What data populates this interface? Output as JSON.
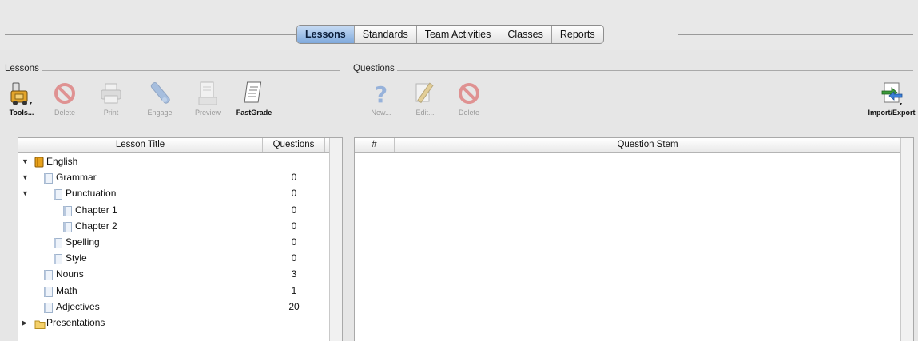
{
  "tabs": [
    {
      "label": "Lessons",
      "active": true
    },
    {
      "label": "Standards",
      "active": false
    },
    {
      "label": "Team Activities",
      "active": false
    },
    {
      "label": "Classes",
      "active": false
    },
    {
      "label": "Reports",
      "active": false
    }
  ],
  "lessons_section": {
    "title": "Lessons",
    "toolbar": [
      {
        "label": "Tools...",
        "icon": "tools-icon",
        "enabled": true
      },
      {
        "label": "Delete",
        "icon": "delete-icon",
        "enabled": false
      },
      {
        "label": "Print",
        "icon": "print-icon",
        "enabled": false
      },
      {
        "label": "Engage",
        "icon": "engage-icon",
        "enabled": false
      },
      {
        "label": "Preview",
        "icon": "preview-icon",
        "enabled": false
      },
      {
        "label": "FastGrade",
        "icon": "fastgrade-icon",
        "enabled": true
      }
    ],
    "columns": {
      "title": "Lesson Title",
      "questions": "Questions"
    },
    "rows": [
      {
        "title": "English",
        "questions": "",
        "level": 0,
        "expander": "expanded",
        "icon": "book-icon"
      },
      {
        "title": "Grammar",
        "questions": "0",
        "level": 1,
        "expander": "expanded",
        "icon": "lesson-doc-icon"
      },
      {
        "title": "Punctuation",
        "questions": "0",
        "level": 2,
        "expander": "expanded",
        "icon": "lesson-doc-icon"
      },
      {
        "title": "Chapter 1",
        "questions": "0",
        "level": 3,
        "expander": "none",
        "icon": "lesson-doc-icon"
      },
      {
        "title": "Chapter 2",
        "questions": "0",
        "level": 3,
        "expander": "none",
        "icon": "lesson-doc-icon"
      },
      {
        "title": "Spelling",
        "questions": "0",
        "level": 2,
        "expander": "none",
        "icon": "lesson-doc-icon"
      },
      {
        "title": "Style",
        "questions": "0",
        "level": 2,
        "expander": "none",
        "icon": "lesson-doc-icon"
      },
      {
        "title": "Nouns",
        "questions": "3",
        "level": 1,
        "expander": "none",
        "icon": "lesson-doc-icon"
      },
      {
        "title": "Math",
        "questions": "1",
        "level": 1,
        "expander": "none",
        "icon": "lesson-doc-icon"
      },
      {
        "title": "Adjectives",
        "questions": "20",
        "level": 1,
        "expander": "none",
        "icon": "lesson-doc-icon"
      },
      {
        "title": "Presentations",
        "questions": "",
        "level": 0,
        "expander": "collapsed",
        "icon": "folder-icon"
      }
    ]
  },
  "questions_section": {
    "title": "Questions",
    "toolbar": [
      {
        "label": "New...",
        "icon": "new-question-icon",
        "enabled": false
      },
      {
        "label": "Edit...",
        "icon": "edit-icon",
        "enabled": false
      },
      {
        "label": "Delete",
        "icon": "delete-icon",
        "enabled": false
      }
    ],
    "import_export": {
      "label": "Import/Export",
      "icon": "import-export-icon",
      "enabled": true
    },
    "columns": {
      "number": "#",
      "stem": "Question Stem"
    }
  },
  "colors": {
    "active_tab": "#7fa9dc",
    "delete_red": "#d94040",
    "disabled_text": "#9b9b9b"
  }
}
